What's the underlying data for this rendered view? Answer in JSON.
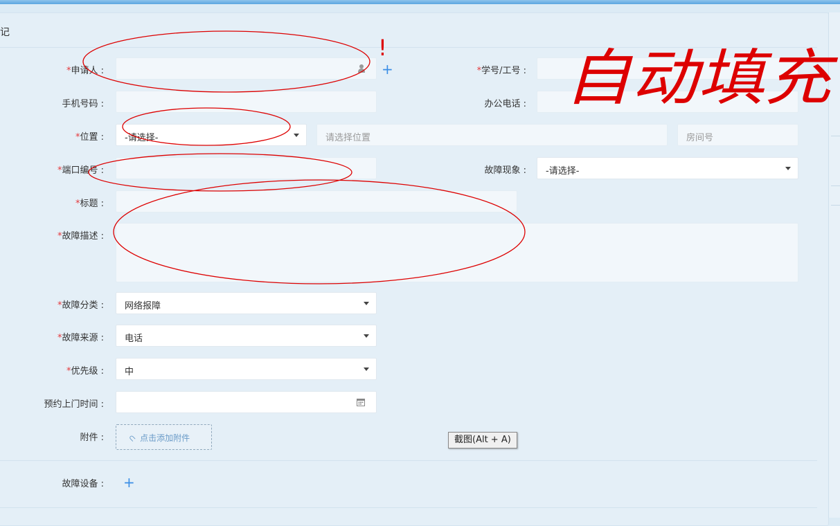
{
  "panel": {
    "title": "记"
  },
  "form": {
    "applicant": {
      "label": "申请人 :"
    },
    "student_id": {
      "label": "学号/工号 :"
    },
    "mobile": {
      "label": "手机号码 :"
    },
    "office_phone": {
      "label": "办公电话 :"
    },
    "location": {
      "label": "位置 :",
      "select_value": "-请选择-",
      "location_placeholder": "请选择位置",
      "room_placeholder": "房间号"
    },
    "port": {
      "label": "端口编号 :"
    },
    "symptom": {
      "label": "故障现象 :",
      "value": "-请选择-"
    },
    "title": {
      "label": "标题 :"
    },
    "description": {
      "label": "故障描述 :"
    },
    "category": {
      "label": "故障分类 :",
      "value": "网络报障"
    },
    "source": {
      "label": "故障来源 :",
      "value": "电话"
    },
    "priority": {
      "label": "优先级 :",
      "value": "中"
    },
    "appointment": {
      "label": "预约上门时间 :"
    },
    "attachment": {
      "label": "附件 :",
      "button": "点击添加附件"
    },
    "devices": {
      "label": "故障设备 :"
    }
  },
  "tooltip": {
    "text": "截图(Alt + A)"
  },
  "annotation": {
    "handwritten_text": "自动填充",
    "mark": "!"
  },
  "colors": {
    "required": "#e4393c",
    "accent": "#3a8ee6",
    "annotation": "#dd0000"
  },
  "icons": {
    "applicant_add": "plus-icon",
    "applicant_picker": "person-icon",
    "date_picker": "calendar-icon",
    "attach": "paperclip-icon",
    "devices_add": "plus-icon"
  }
}
